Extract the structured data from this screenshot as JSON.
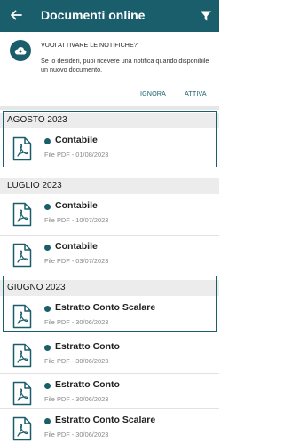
{
  "app_bar": {
    "title": "Documenti online",
    "back_icon": "arrow-left-icon",
    "filter_icon": "filter-icon",
    "color": "#1b5e6b"
  },
  "notification": {
    "icon": "cloud-notification-icon",
    "heading": "VUOI ATTIVARE LE NOTIFICHE?",
    "body": "Se lo desideri, puoi ricevere una notifica quando disponibile un nuovo documento.",
    "ignore_label": "IGNORA",
    "activate_label": "ATTIVA"
  },
  "sections": [
    {
      "title": "AGOSTO 2023",
      "items": [
        {
          "name": "Contabile",
          "meta": "File PDF - 01/08/2023"
        }
      ]
    },
    {
      "title": "LUGLIO 2023",
      "items": [
        {
          "name": "Contabile",
          "meta": "File PDF - 10/07/2023"
        },
        {
          "name": "Contabile",
          "meta": "File PDF - 03/07/2023"
        }
      ]
    },
    {
      "title": "GIUGNO 2023",
      "items": [
        {
          "name": "Estratto Conto Scalare",
          "meta": "File PDF - 30/06/2023"
        },
        {
          "name": "Estratto Conto",
          "meta": "File PDF - 30/06/2023"
        },
        {
          "name": "Estratto Conto",
          "meta": "File PDF - 30/06/2023"
        },
        {
          "name": "Estratto Conto Scalare",
          "meta": "File PDF - 30/06/2023"
        }
      ]
    }
  ],
  "document_icon": "pdf-file-icon",
  "unread_color": "#1b5e6b"
}
